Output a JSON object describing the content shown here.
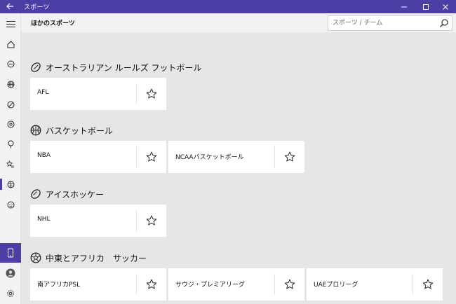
{
  "titlebar": {
    "title": "スポーツ",
    "back_icon": "back-arrow-icon",
    "minimize_icon": "minimize-icon",
    "maximize_icon": "maximize-icon",
    "close_icon": "close-icon"
  },
  "header": {
    "page_title": "ほかのスポーツ"
  },
  "search": {
    "placeholder": "スポーツ / チーム",
    "value": ""
  },
  "colors": {
    "accent": "#4b3fa6",
    "background": "#e6e6e6",
    "nav_background": "#f2f2f2",
    "card": "#ffffff"
  },
  "nav": {
    "items": [
      "hamburger-icon",
      "home-icon",
      "sport-ball-icon",
      "basketball-icon",
      "baseball-icon",
      "soccer-icon",
      "golf-icon",
      "favorites-icon",
      "other-sports-icon",
      "emoji-icon"
    ],
    "selected": "other-sports-icon",
    "bottom": [
      "phone-icon",
      "account-icon",
      "settings-icon"
    ]
  },
  "sections": [
    {
      "title": "オーストラリアン ルールズ フットボール",
      "icon": "football-icon",
      "leagues": [
        {
          "label": "AFL"
        }
      ]
    },
    {
      "title": "バスケットボール",
      "icon": "basketball-icon",
      "leagues": [
        {
          "label": "NBA"
        },
        {
          "label": "NCAAバスケットボール"
        }
      ]
    },
    {
      "title": "アイスホッケー",
      "icon": "puck-icon",
      "leagues": [
        {
          "label": "NHL"
        }
      ]
    },
    {
      "title": "中東とアフリカ　サッカー",
      "icon": "soccer-ball-icon",
      "leagues": [
        {
          "label": "南アフリカPSL"
        },
        {
          "label": "サウジ・プレミアリーグ"
        },
        {
          "label": "UAEプロリーグ"
        }
      ]
    }
  ]
}
